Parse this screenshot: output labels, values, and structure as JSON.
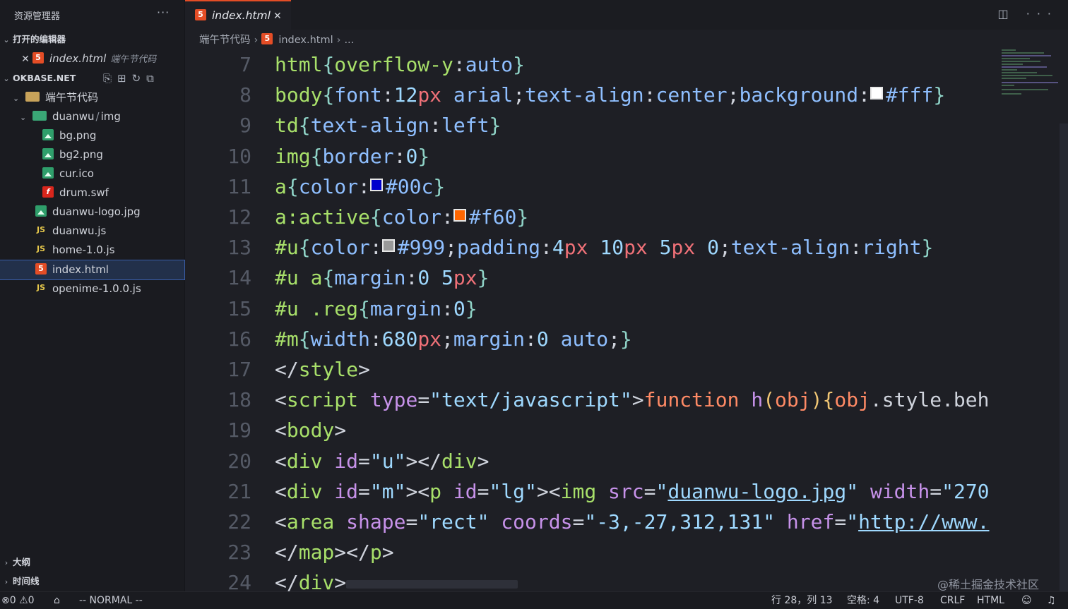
{
  "sidebar": {
    "title": "资源管理器",
    "more": "···",
    "open_editors": {
      "label": "打开的编辑器",
      "items": [
        {
          "name": "index.html",
          "hint": "端午节代码"
        }
      ]
    },
    "workspace": {
      "label": "OKBASE.NET",
      "folder": "端午节代码",
      "subfolder": "duanwu",
      "subfolder_compact": "img",
      "sep": "/",
      "img_files": [
        "bg.png",
        "bg2.png",
        "cur.ico",
        "drum.swf"
      ],
      "files": [
        "duanwu-logo.jpg",
        "duanwu.js",
        "home-1.0.js",
        "index.html",
        "openime-1.0.0.js"
      ]
    },
    "outline": "大纲",
    "timeline": "时间线"
  },
  "tab": {
    "label": "index.html",
    "close": "✕"
  },
  "tab_actions": "◫ ···",
  "breadcrumb": {
    "folder": "端午节代码",
    "file": "index.html",
    "tail": "..."
  },
  "editor": {
    "lines": [
      {
        "n": "7",
        "tokens": [
          {
            "t": "html",
            "c": "#a8e06a"
          },
          {
            "t": "{",
            "c": "#8fd3c7"
          },
          {
            "t": "overflow-y",
            "c": "#a8e06a"
          },
          {
            "t": ":",
            "c": "#cfd3dc"
          },
          {
            "t": "auto",
            "c": "#8fbfff"
          },
          {
            "t": "}",
            "c": "#8fd3c7"
          }
        ]
      },
      {
        "n": "8",
        "tokens": [
          {
            "t": "body",
            "c": "#a8e06a"
          },
          {
            "t": "{",
            "c": "#8fd3c7"
          },
          {
            "t": "font",
            "c": "#8fbfff"
          },
          {
            "t": ":",
            "c": "#cfd3dc"
          },
          {
            "t": "12",
            "c": "#9fd9ff"
          },
          {
            "t": "px",
            "c": "#f07178"
          },
          {
            "t": " arial",
            "c": "#8fbfff"
          },
          {
            "t": ";",
            "c": "#cfd3dc"
          },
          {
            "t": "text-align",
            "c": "#8fbfff"
          },
          {
            "t": ":",
            "c": "#cfd3dc"
          },
          {
            "t": "center",
            "c": "#8fbfff"
          },
          {
            "t": ";",
            "c": "#cfd3dc"
          },
          {
            "t": "background",
            "c": "#8fbfff"
          },
          {
            "t": ":",
            "c": "#cfd3dc"
          },
          {
            "sw": "#ffffff"
          },
          {
            "t": "#fff",
            "c": "#8fbfff"
          },
          {
            "t": "}",
            "c": "#8fd3c7"
          }
        ]
      },
      {
        "n": "9",
        "tokens": [
          {
            "t": "td",
            "c": "#a8e06a"
          },
          {
            "t": "{",
            "c": "#8fd3c7"
          },
          {
            "t": "text-align",
            "c": "#8fbfff"
          },
          {
            "t": ":",
            "c": "#cfd3dc"
          },
          {
            "t": "left",
            "c": "#8fbfff"
          },
          {
            "t": "}",
            "c": "#8fd3c7"
          }
        ]
      },
      {
        "n": "10",
        "tokens": [
          {
            "t": "img",
            "c": "#a8e06a"
          },
          {
            "t": "{",
            "c": "#8fd3c7"
          },
          {
            "t": "border",
            "c": "#8fbfff"
          },
          {
            "t": ":",
            "c": "#cfd3dc"
          },
          {
            "t": "0",
            "c": "#9fd9ff"
          },
          {
            "t": "}",
            "c": "#8fd3c7"
          }
        ]
      },
      {
        "n": "11",
        "tokens": [
          {
            "t": "a",
            "c": "#a8e06a"
          },
          {
            "t": "{",
            "c": "#8fd3c7"
          },
          {
            "t": "color",
            "c": "#8fbfff"
          },
          {
            "t": ":",
            "c": "#cfd3dc"
          },
          {
            "sw": "#0000cc"
          },
          {
            "t": "#00c",
            "c": "#8fbfff"
          },
          {
            "t": "}",
            "c": "#8fd3c7"
          }
        ]
      },
      {
        "n": "12",
        "tokens": [
          {
            "t": "a",
            "c": "#a8e06a"
          },
          {
            "t": ":active",
            "c": "#a8e06a"
          },
          {
            "t": "{",
            "c": "#8fd3c7"
          },
          {
            "t": "color",
            "c": "#8fbfff"
          },
          {
            "t": ":",
            "c": "#cfd3dc"
          },
          {
            "sw": "#ff6600"
          },
          {
            "t": "#f60",
            "c": "#8fbfff"
          },
          {
            "t": "}",
            "c": "#8fd3c7"
          }
        ]
      },
      {
        "n": "13",
        "tokens": [
          {
            "t": "#u",
            "c": "#a8e06a"
          },
          {
            "t": "{",
            "c": "#8fd3c7"
          },
          {
            "t": "color",
            "c": "#8fbfff"
          },
          {
            "t": ":",
            "c": "#cfd3dc"
          },
          {
            "sw": "#999999"
          },
          {
            "t": "#999",
            "c": "#8fbfff"
          },
          {
            "t": ";",
            "c": "#cfd3dc"
          },
          {
            "t": "padding",
            "c": "#8fbfff"
          },
          {
            "t": ":",
            "c": "#cfd3dc"
          },
          {
            "t": "4",
            "c": "#9fd9ff"
          },
          {
            "t": "px",
            "c": "#f07178"
          },
          {
            "t": " 10",
            "c": "#9fd9ff"
          },
          {
            "t": "px",
            "c": "#f07178"
          },
          {
            "t": " 5",
            "c": "#9fd9ff"
          },
          {
            "t": "px",
            "c": "#f07178"
          },
          {
            "t": " 0",
            "c": "#9fd9ff"
          },
          {
            "t": ";",
            "c": "#cfd3dc"
          },
          {
            "t": "text-align",
            "c": "#8fbfff"
          },
          {
            "t": ":",
            "c": "#cfd3dc"
          },
          {
            "t": "right",
            "c": "#8fbfff"
          },
          {
            "t": "}",
            "c": "#8fd3c7"
          }
        ]
      },
      {
        "n": "14",
        "tokens": [
          {
            "t": "#u",
            "c": "#a8e06a"
          },
          {
            "t": " a",
            "c": "#a8e06a"
          },
          {
            "t": "{",
            "c": "#8fd3c7"
          },
          {
            "t": "margin",
            "c": "#8fbfff"
          },
          {
            "t": ":",
            "c": "#cfd3dc"
          },
          {
            "t": "0",
            "c": "#9fd9ff"
          },
          {
            "t": " 5",
            "c": "#9fd9ff"
          },
          {
            "t": "px",
            "c": "#f07178"
          },
          {
            "t": "}",
            "c": "#8fd3c7"
          }
        ]
      },
      {
        "n": "15",
        "tokens": [
          {
            "t": "#u",
            "c": "#a8e06a"
          },
          {
            "t": " .reg",
            "c": "#a8e06a"
          },
          {
            "t": "{",
            "c": "#8fd3c7"
          },
          {
            "t": "margin",
            "c": "#8fbfff"
          },
          {
            "t": ":",
            "c": "#cfd3dc"
          },
          {
            "t": "0",
            "c": "#9fd9ff"
          },
          {
            "t": "}",
            "c": "#8fd3c7"
          }
        ]
      },
      {
        "n": "16",
        "tokens": [
          {
            "t": "#m",
            "c": "#a8e06a"
          },
          {
            "t": "{",
            "c": "#8fd3c7"
          },
          {
            "t": "width",
            "c": "#8fbfff"
          },
          {
            "t": ":",
            "c": "#cfd3dc"
          },
          {
            "t": "680",
            "c": "#9fd9ff"
          },
          {
            "t": "px",
            "c": "#f07178"
          },
          {
            "t": ";",
            "c": "#cfd3dc"
          },
          {
            "t": "margin",
            "c": "#8fbfff"
          },
          {
            "t": ":",
            "c": "#cfd3dc"
          },
          {
            "t": "0",
            "c": "#9fd9ff"
          },
          {
            "t": " auto",
            "c": "#8fbfff"
          },
          {
            "t": ";",
            "c": "#cfd3dc"
          },
          {
            "t": "}",
            "c": "#8fd3c7"
          }
        ]
      },
      {
        "n": "17",
        "tokens": [
          {
            "t": "</",
            "c": "#cfd3dc"
          },
          {
            "t": "style",
            "c": "#a8e06a"
          },
          {
            "t": ">",
            "c": "#cfd3dc"
          }
        ]
      },
      {
        "n": "18",
        "tokens": [
          {
            "t": "<",
            "c": "#cfd3dc"
          },
          {
            "t": "script",
            "c": "#a8e06a"
          },
          {
            "t": " type",
            "c": "#c792ea"
          },
          {
            "t": "=",
            "c": "#cfd3dc"
          },
          {
            "t": "\"text/javascript\"",
            "c": "#9fd9ff"
          },
          {
            "t": ">",
            "c": "#cfd3dc"
          },
          {
            "t": "function",
            "c": "#ff8a65"
          },
          {
            "t": " h",
            "c": "#c792ea"
          },
          {
            "t": "(",
            "c": "#f0c674"
          },
          {
            "t": "obj",
            "c": "#ff8a65"
          },
          {
            "t": ")",
            "c": "#f0c674"
          },
          {
            "t": "{",
            "c": "#f0c674"
          },
          {
            "t": "obj",
            "c": "#ff8a65"
          },
          {
            "t": ".style.beh",
            "c": "#cfd3dc"
          }
        ]
      },
      {
        "n": "19",
        "tokens": [
          {
            "t": "<",
            "c": "#cfd3dc"
          },
          {
            "t": "body",
            "c": "#a8e06a"
          },
          {
            "t": ">",
            "c": "#cfd3dc"
          }
        ]
      },
      {
        "n": "20",
        "tokens": [
          {
            "t": "<",
            "c": "#cfd3dc"
          },
          {
            "t": "div",
            "c": "#a8e06a"
          },
          {
            "t": " id",
            "c": "#c792ea"
          },
          {
            "t": "=",
            "c": "#cfd3dc"
          },
          {
            "t": "\"u\"",
            "c": "#9fd9ff"
          },
          {
            "t": "></",
            "c": "#cfd3dc"
          },
          {
            "t": "div",
            "c": "#a8e06a"
          },
          {
            "t": ">",
            "c": "#cfd3dc"
          }
        ]
      },
      {
        "n": "21",
        "tokens": [
          {
            "t": "<",
            "c": "#cfd3dc"
          },
          {
            "t": "div",
            "c": "#a8e06a"
          },
          {
            "t": " id",
            "c": "#c792ea"
          },
          {
            "t": "=",
            "c": "#cfd3dc"
          },
          {
            "t": "\"m\"",
            "c": "#9fd9ff"
          },
          {
            "t": "><",
            "c": "#cfd3dc"
          },
          {
            "t": "p",
            "c": "#a8e06a"
          },
          {
            "t": " id",
            "c": "#c792ea"
          },
          {
            "t": "=",
            "c": "#cfd3dc"
          },
          {
            "t": "\"lg\"",
            "c": "#9fd9ff"
          },
          {
            "t": "><",
            "c": "#cfd3dc"
          },
          {
            "t": "img",
            "c": "#a8e06a"
          },
          {
            "t": " src",
            "c": "#c792ea"
          },
          {
            "t": "=",
            "c": "#cfd3dc"
          },
          {
            "t": "\"",
            "c": "#9fd9ff"
          },
          {
            "t": "duanwu-logo.jpg",
            "c": "#9fd9ff",
            "u": true
          },
          {
            "t": "\"",
            "c": "#9fd9ff"
          },
          {
            "t": " width",
            "c": "#c792ea"
          },
          {
            "t": "=",
            "c": "#cfd3dc"
          },
          {
            "t": "\"270",
            "c": "#9fd9ff"
          }
        ]
      },
      {
        "n": "22",
        "tokens": [
          {
            "t": "<",
            "c": "#cfd3dc"
          },
          {
            "t": "area",
            "c": "#a8e06a"
          },
          {
            "t": " shape",
            "c": "#c792ea"
          },
          {
            "t": "=",
            "c": "#cfd3dc"
          },
          {
            "t": "\"rect\"",
            "c": "#9fd9ff"
          },
          {
            "t": " coords",
            "c": "#c792ea"
          },
          {
            "t": "=",
            "c": "#cfd3dc"
          },
          {
            "t": "\"-3,-27,312,131\"",
            "c": "#9fd9ff"
          },
          {
            "t": " href",
            "c": "#c792ea"
          },
          {
            "t": "=",
            "c": "#cfd3dc"
          },
          {
            "t": "\"",
            "c": "#9fd9ff"
          },
          {
            "t": "http://www.",
            "c": "#9fd9ff",
            "u": true
          }
        ]
      },
      {
        "n": "23",
        "tokens": [
          {
            "t": "</",
            "c": "#cfd3dc"
          },
          {
            "t": "map",
            "c": "#a8e06a"
          },
          {
            "t": "></",
            "c": "#cfd3dc"
          },
          {
            "t": "p",
            "c": "#a8e06a"
          },
          {
            "t": ">",
            "c": "#cfd3dc"
          }
        ]
      },
      {
        "n": "24",
        "tokens": [
          {
            "t": "</",
            "c": "#cfd3dc"
          },
          {
            "t": "div",
            "c": "#a8e06a"
          },
          {
            "t": ">",
            "c": "#cfd3dc"
          }
        ]
      }
    ]
  },
  "watermark": "@稀土掘金技术社区",
  "status": {
    "errors": "0",
    "warnings": "0",
    "mode": "-- NORMAL --",
    "position": "行 28，列 13",
    "spaces": "空格: 4",
    "encoding": "UTF-8",
    "eol": "CRLF",
    "language": "HTML"
  }
}
